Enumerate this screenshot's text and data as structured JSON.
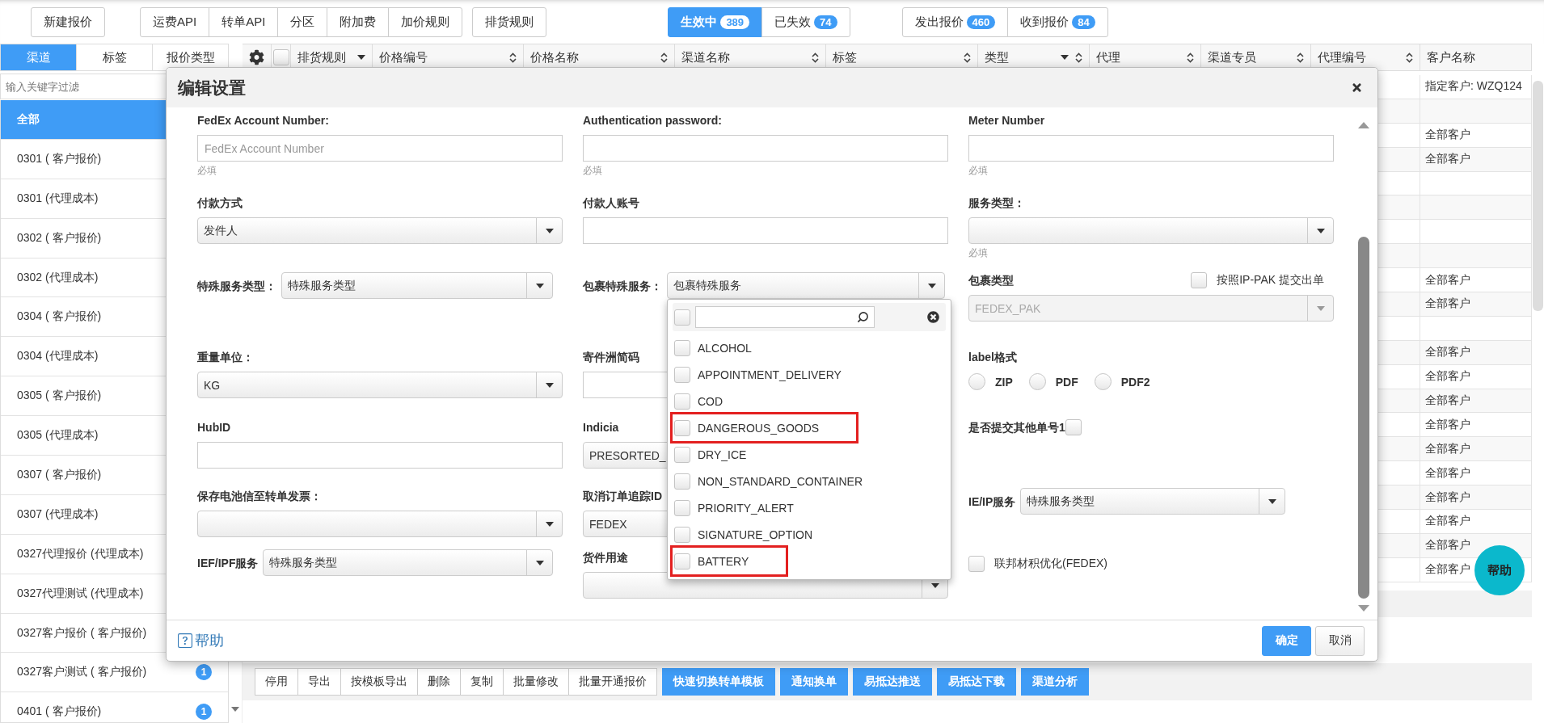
{
  "toolbar": {
    "groups": [
      [
        {
          "label": "新建报价"
        }
      ],
      [
        {
          "label": "运费API"
        },
        {
          "label": "转单API"
        },
        {
          "label": "分区"
        },
        {
          "label": "附加费"
        },
        {
          "label": "加价规则"
        }
      ],
      [
        {
          "label": "排货规则"
        }
      ]
    ]
  },
  "status_tabs": [
    {
      "label": "生效中",
      "count": "389",
      "selected": true
    },
    {
      "label": "已失效",
      "count": "74",
      "selected": false
    }
  ],
  "quote_tabs": [
    {
      "label": "发出报价",
      "count": "460",
      "selected": false
    },
    {
      "label": "收到报价",
      "count": "84",
      "selected": false
    }
  ],
  "sidebar": {
    "tabs": [
      {
        "label": "渠道",
        "selected": true
      },
      {
        "label": "标签",
        "selected": false
      },
      {
        "label": "报价类型",
        "selected": false
      }
    ],
    "filter": {
      "placeholder": "输入关键字过滤"
    },
    "items": [
      {
        "label": "全部",
        "selected": true
      },
      {
        "label": "0301 ( 客户报价)",
        "selected": false
      },
      {
        "label": "0301 (代理成本)",
        "selected": false
      },
      {
        "label": "0302 ( 客户报价)",
        "selected": false
      },
      {
        "label": "0302 (代理成本)",
        "selected": false
      },
      {
        "label": "0304 ( 客户报价)",
        "selected": false
      },
      {
        "label": "0304 (代理成本)",
        "selected": false
      },
      {
        "label": "0305 ( 客户报价)",
        "selected": false
      },
      {
        "label": "0305 (代理成本)",
        "selected": false
      },
      {
        "label": "0307 ( 客户报价)",
        "selected": false
      },
      {
        "label": "0307 (代理成本)",
        "selected": false
      },
      {
        "label": "0327代理报价 (代理成本)",
        "selected": false
      },
      {
        "label": "0327代理测试 (代理成本)",
        "selected": false
      },
      {
        "label": "0327客户报价 ( 客户报价)",
        "selected": false
      },
      {
        "label": "0327客户测试 ( 客户报价)",
        "selected": false,
        "badge": "1"
      },
      {
        "label": "0401 ( 客户报价)",
        "selected": false,
        "badge": "1"
      }
    ]
  },
  "table": {
    "select_all": {
      "checked": false
    },
    "columns": [
      {
        "label": "排货规则",
        "kind": "filter"
      },
      {
        "label": "价格编号",
        "kind": "sort"
      },
      {
        "label": "价格名称",
        "kind": "sort"
      },
      {
        "label": "渠道名称",
        "kind": "sort"
      },
      {
        "label": "标签",
        "kind": "sort"
      },
      {
        "label": "类型",
        "kind": "filter_sort"
      },
      {
        "label": "代理",
        "kind": "sort"
      },
      {
        "label": "渠道专员",
        "kind": "sort"
      },
      {
        "label": "代理编号",
        "kind": "sort"
      },
      {
        "label": "客户名称",
        "kind": "plain"
      }
    ],
    "rows": [
      {
        "customer": "指定客户: WZQ124"
      },
      {},
      {
        "customer": "全部客户"
      },
      {
        "customer": "全部客户"
      },
      {},
      {},
      {},
      {},
      {
        "customer": "全部客户"
      },
      {
        "customer": "全部客户"
      },
      {},
      {
        "customer": "全部客户"
      },
      {
        "customer": "全部客户"
      },
      {
        "customer": "全部客户"
      },
      {
        "customer": "全部客户"
      },
      {
        "customer": "全部客户"
      },
      {
        "customer": "全部客户"
      },
      {
        "customer": "全部客户"
      },
      {
        "customer": "全部客户"
      },
      {
        "customer": "全部客户"
      },
      {
        "customer": "全部客户"
      }
    ]
  },
  "actions": [
    {
      "label": "停用",
      "kind": "plain"
    },
    {
      "label": "导出",
      "kind": "plain"
    },
    {
      "label": "按模板导出",
      "kind": "plain"
    },
    {
      "label": "删除",
      "kind": "plain"
    },
    {
      "label": "复制",
      "kind": "plain"
    },
    {
      "label": "批量修改",
      "kind": "plain"
    },
    {
      "label": "批量开通报价",
      "kind": "plain"
    },
    {
      "label": "快速切换转单模板",
      "kind": "primary"
    },
    {
      "label": "通知换单",
      "kind": "primary"
    },
    {
      "label": "易抵达推送",
      "kind": "primary"
    },
    {
      "label": "易抵达下载",
      "kind": "primary"
    },
    {
      "label": "渠道分析",
      "kind": "primary"
    }
  ],
  "help_button": {
    "label": "帮助"
  },
  "dialog": {
    "title": "编辑设置",
    "rows": [
      [
        {
          "kind": "input",
          "label": "FedEx Account Number:",
          "placeholder": "FedEx Account Number",
          "hint": "必填"
        },
        {
          "kind": "input",
          "label": "Authentication password:",
          "hint": "必填"
        },
        {
          "kind": "input",
          "label": "Meter Number",
          "hint": "必填"
        }
      ],
      [
        {
          "kind": "select",
          "label": "付款方式",
          "value": "发件人",
          "disabled": false
        },
        {
          "kind": "input",
          "label": "付款人账号"
        },
        {
          "kind": "select",
          "label": "服务类型：",
          "hint": "必填",
          "disabled": false
        }
      ],
      [
        {
          "kind": "inline_select",
          "label": "特殊服务类型：",
          "value": "特殊服务类型"
        },
        {
          "kind": "inline_select",
          "label": "包裹特殊服务：",
          "value": "包裹特殊服务",
          "dropdown": {
            "select_all": {
              "checked": false
            },
            "options": [
              {
                "label": "ALCOHOL",
                "checked": false,
                "highlighted": false
              },
              {
                "label": "APPOINTMENT_DELIVERY",
                "checked": false,
                "highlighted": false
              },
              {
                "label": "COD",
                "checked": false,
                "highlighted": false
              },
              {
                "label": "DANGEROUS_GOODS",
                "checked": false,
                "highlighted": true
              },
              {
                "label": "DRY_ICE",
                "checked": false,
                "highlighted": false
              },
              {
                "label": "NON_STANDARD_CONTAINER",
                "checked": false,
                "highlighted": false
              },
              {
                "label": "PRIORITY_ALERT",
                "checked": false,
                "highlighted": false
              },
              {
                "label": "SIGNATURE_OPTION",
                "checked": false,
                "highlighted": false
              },
              {
                "label": "BATTERY",
                "checked": false,
                "highlighted": true
              }
            ]
          }
        },
        {
          "kind": "select",
          "label": "包裹类型",
          "value": "FEDEX_PAK",
          "disabled": true,
          "side_check": {
            "label": "按照IP-PAK 提交出单",
            "checked": false
          }
        }
      ],
      [
        {
          "kind": "select",
          "label": "重量单位：",
          "value": "KG",
          "disabled": false
        },
        {
          "kind": "input",
          "label": "寄件洲简码"
        },
        {
          "kind": "radios",
          "label": "label格式",
          "options": [
            {
              "label": "ZIP",
              "selected": false
            },
            {
              "label": "PDF",
              "selected": false
            },
            {
              "label": "PDF2",
              "selected": false
            }
          ]
        }
      ],
      [
        {
          "kind": "input",
          "label": "HubID"
        },
        {
          "kind": "select",
          "label": "Indicia",
          "value": "PRESORTED_",
          "disabled": false
        },
        {
          "kind": "check_after",
          "label": "是否提交其他单号1",
          "checked": false
        }
      ],
      [
        {
          "kind": "select",
          "label": "保存电池信至转单发票：",
          "disabled": false
        },
        {
          "kind": "select",
          "label": "取消订单追踪ID",
          "value": "FEDEX",
          "disabled": false
        },
        {
          "kind": "inline_select",
          "label": "IE/IP服务",
          "value": "特殊服务类型"
        }
      ],
      [
        {
          "kind": "inline_select",
          "label": "IEF/IPF服务",
          "value": "特殊服务类型"
        },
        {
          "kind": "select",
          "label": "货件用途",
          "disabled": false
        },
        {
          "kind": "checkbox",
          "label": "联邦材积优化(FEDEX)",
          "checked": false
        }
      ]
    ],
    "help_link": "帮助",
    "buttons": [
      {
        "label": "确定",
        "kind": "primary"
      },
      {
        "label": "取消",
        "kind": "default"
      }
    ]
  }
}
